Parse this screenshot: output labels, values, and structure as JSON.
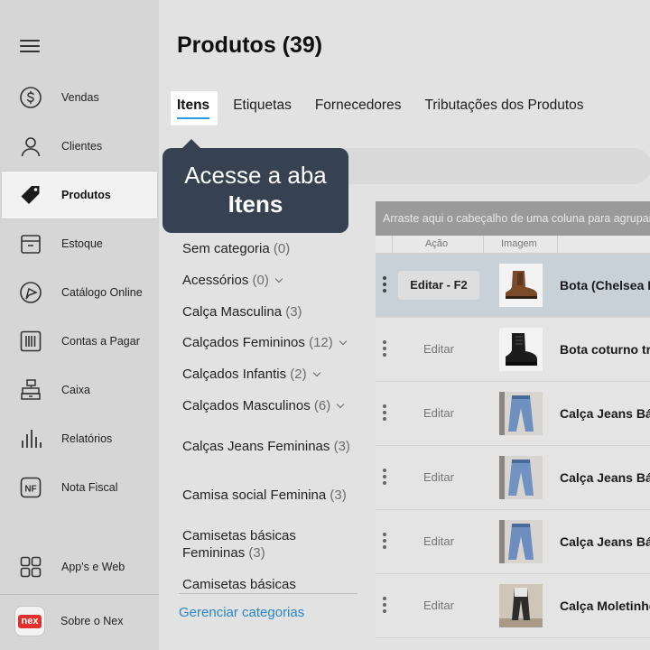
{
  "sidebar": {
    "items": [
      {
        "label": "Vendas",
        "icon": "dollar-circle-icon"
      },
      {
        "label": "Clientes",
        "icon": "user-icon"
      },
      {
        "label": "Produtos",
        "icon": "tag-icon"
      },
      {
        "label": "Estoque",
        "icon": "box-icon"
      },
      {
        "label": "Catálogo Online",
        "icon": "catalog-icon"
      },
      {
        "label": "Contas a Pagar",
        "icon": "barcode-icon"
      },
      {
        "label": "Caixa",
        "icon": "cash-register-icon"
      },
      {
        "label": "Relatórios",
        "icon": "bar-chart-icon"
      },
      {
        "label": "Nota Fiscal",
        "icon": "nf-icon"
      },
      {
        "label": "App's e Web",
        "icon": "grid-icon"
      },
      {
        "label": "Sobre o Nex",
        "icon": "nex-logo-icon"
      }
    ],
    "nf_badge": "NF",
    "nex_logo_text": "nex"
  },
  "main": {
    "title": "Produtos (39)",
    "tabs": [
      "Itens",
      "Etiquetas",
      "Fornecedores",
      "Tributações dos Produtos"
    ],
    "active_tab": "Itens"
  },
  "tooltip": {
    "line1": "Acesse a aba",
    "line2": "Itens"
  },
  "categories": [
    {
      "name": "Sem categoria",
      "count": "(0)"
    },
    {
      "name": "Acessórios",
      "count": "(0)"
    },
    {
      "name": "Calça Masculina",
      "count": "(3)"
    },
    {
      "name": "Calçados Femininos",
      "count": "(12)"
    },
    {
      "name": "Calçados Infantis",
      "count": "(2)"
    },
    {
      "name": "Calçados Masculinos",
      "count": "(6)"
    },
    {
      "name": "Calças Jeans Femininas",
      "count": "(3)"
    },
    {
      "name": "Camisa social Feminina",
      "count": "(3)"
    },
    {
      "name": "Camisetas básicas Femininas",
      "count": "(3)"
    },
    {
      "name": "Camisetas básicas",
      "count": ""
    }
  ],
  "manage_categories": "Gerenciar categorias",
  "grid": {
    "group_hint": "Arraste aqui o cabeçalho de uma coluna para agrupar",
    "columns": {
      "action": "Ação",
      "image": "Imagem"
    },
    "rows": [
      {
        "edit": "Editar - F2",
        "name": "Bota (Chelsea Boot)"
      },
      {
        "edit": "Editar",
        "name": "Bota coturno tratorada"
      },
      {
        "edit": "Editar",
        "name": "Calça Jeans Básica"
      },
      {
        "edit": "Editar",
        "name": "Calça Jeans Básica"
      },
      {
        "edit": "Editar",
        "name": "Calça Jeans Básica"
      },
      {
        "edit": "Editar",
        "name": "Calça Moletinho"
      }
    ]
  },
  "colors": {
    "sidebar_bg": "#d6d6d6",
    "tooltip_bg": "#364152",
    "link": "#2a86c8",
    "accent": "#2a9de0",
    "brand_red": "#e2312d"
  }
}
